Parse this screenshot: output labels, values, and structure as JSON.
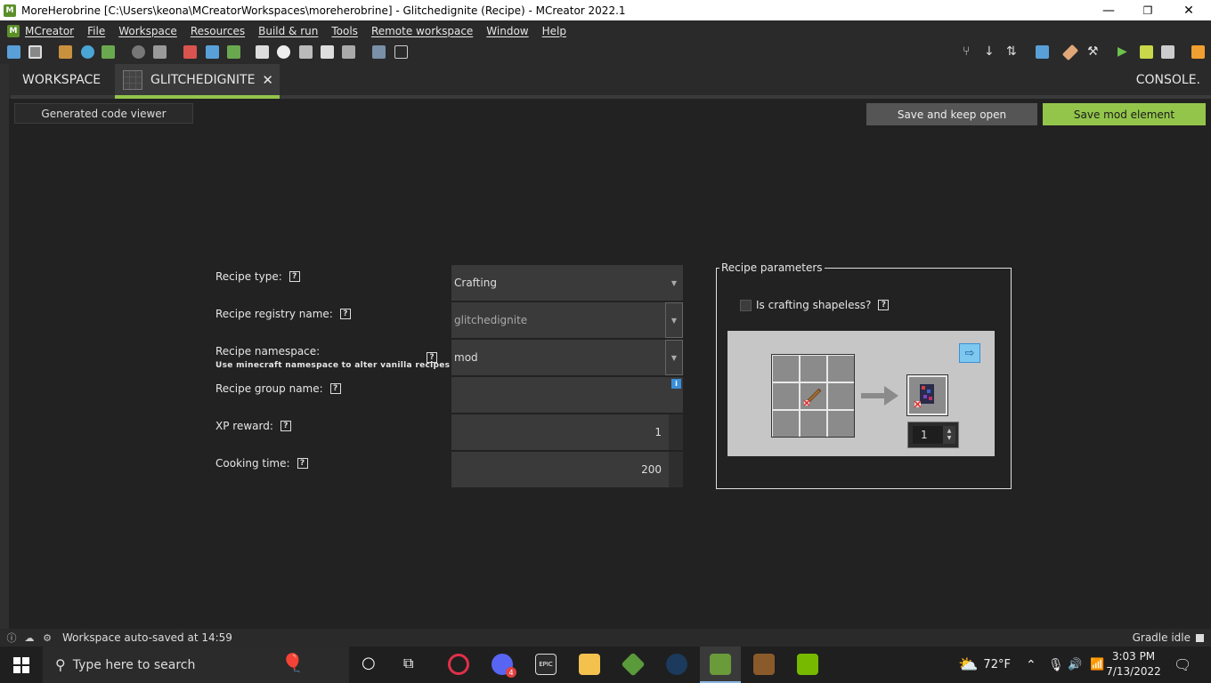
{
  "window": {
    "title": "MoreHerobrine [C:\\Users\\keona\\MCreatorWorkspaces\\moreherobrine] - Glitchedignite (Recipe) - MCreator 2022.1",
    "minimize": "—",
    "maximize": "❐",
    "close": "✕"
  },
  "menu": {
    "items": [
      "MCreator",
      "File",
      "Workspace",
      "Resources",
      "Build & run",
      "Tools",
      "Remote workspace",
      "Window",
      "Help"
    ]
  },
  "tabs": {
    "workspace": "WORKSPACE",
    "active": "GLITCHEDIGNITE",
    "close": "✕",
    "console": "CONSOLE."
  },
  "actions": {
    "code_viewer": "Generated code viewer",
    "save_keep_open": "Save and keep open",
    "save_mod_element": "Save mod element"
  },
  "form": {
    "recipe_type_label": "Recipe type:",
    "recipe_type_value": "Crafting",
    "registry_name_label": "Recipe registry name:",
    "registry_name_value": "glitchedignite",
    "namespace_label": "Recipe namespace:",
    "namespace_hint": "Use minecraft namespace to alter vanilla recipes",
    "namespace_value": "mod",
    "group_name_label": "Recipe group name:",
    "group_name_value": "",
    "xp_label": "XP reward:",
    "xp_value": "1",
    "cooking_label": "Cooking time:",
    "cooking_value": "200",
    "help_glyph": "?",
    "info_glyph": "i"
  },
  "recipe_params": {
    "title": "Recipe parameters",
    "shapeless_label": "Is crafting shapeless?",
    "shapeless_checked": false,
    "result_count": "1"
  },
  "status": {
    "message": "Workspace auto-saved at 14:59",
    "gradle": "Gradle idle"
  },
  "taskbar": {
    "search_placeholder": "Type here to search",
    "weather": "72°F",
    "time": "3:03 PM",
    "date": "7/13/2022",
    "discord_badge": "4"
  },
  "colors": {
    "accent": "#93c54b",
    "background": "#222222",
    "panel": "#3a3a3a"
  }
}
